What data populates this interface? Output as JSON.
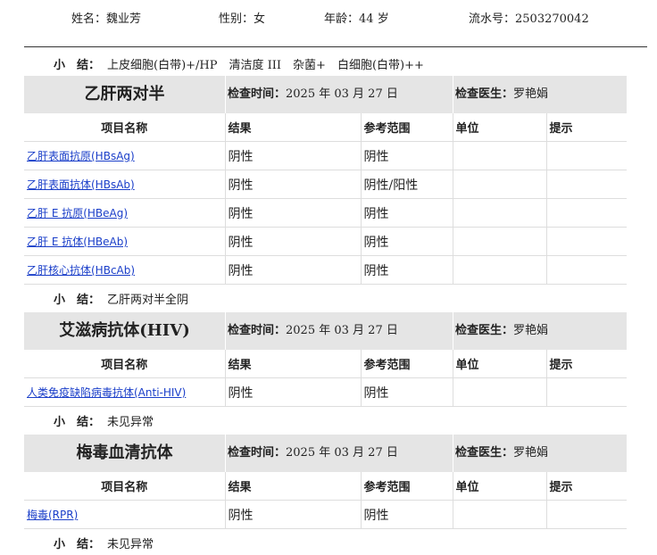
{
  "patient": {
    "name_label": "姓名：",
    "name": "魏业芳",
    "gender_label": "性别：",
    "gender": "女",
    "age_label": "年龄：",
    "age": "44 岁",
    "serial_label": "流水号：",
    "serial": "2503270042"
  },
  "summary_label": "小　结：",
  "top_summary": "上皮细胞(白带)+/HP　清洁度 III　杂菌+　白细胞(白带)++",
  "sections": [
    {
      "title": "乙肝两对半",
      "time_label": "检查时间：",
      "time": "2025 年 03 月 27 日",
      "doctor_label": "检查医生：",
      "doctor": "罗艳娟",
      "headers": [
        "项目名称",
        "结果",
        "参考范围",
        "单位",
        "提示"
      ],
      "rows": [
        {
          "name": "乙肝表面抗原(HBsAg)",
          "result": "阴性",
          "ref": "阴性",
          "unit": "",
          "hint": ""
        },
        {
          "name": "乙肝表面抗体(HBsAb)",
          "result": "阴性",
          "ref": "阴性/阳性",
          "unit": "",
          "hint": ""
        },
        {
          "name": "乙肝 E 抗原(HBeAg)",
          "result": "阴性",
          "ref": "阴性",
          "unit": "",
          "hint": ""
        },
        {
          "name": "乙肝 E 抗体(HBeAb)",
          "result": "阴性",
          "ref": "阴性",
          "unit": "",
          "hint": ""
        },
        {
          "name": "乙肝核心抗体(HBcAb)",
          "result": "阴性",
          "ref": "阴性",
          "unit": "",
          "hint": ""
        }
      ],
      "summary": "乙肝两对半全阴"
    },
    {
      "title": "艾滋病抗体(HIV)",
      "time_label": "检查时间：",
      "time": "2025 年 03 月 27 日",
      "doctor_label": "检查医生：",
      "doctor": "罗艳娟",
      "headers": [
        "项目名称",
        "结果",
        "参考范围",
        "单位",
        "提示"
      ],
      "rows": [
        {
          "name": "人类免疫缺陷病毒抗体(Anti-HIV)",
          "result": "阴性",
          "ref": "阴性",
          "unit": "",
          "hint": ""
        }
      ],
      "summary": "未见异常"
    },
    {
      "title": "梅毒血清抗体",
      "time_label": "检查时间：",
      "time": "2025 年 03 月 27 日",
      "doctor_label": "检查医生：",
      "doctor": "罗艳娟",
      "headers": [
        "项目名称",
        "结果",
        "参考范围",
        "单位",
        "提示"
      ],
      "rows": [
        {
          "name": "梅毒(RPR)",
          "result": "阴性",
          "ref": "阴性",
          "unit": "",
          "hint": ""
        }
      ],
      "summary": "未见异常"
    }
  ]
}
